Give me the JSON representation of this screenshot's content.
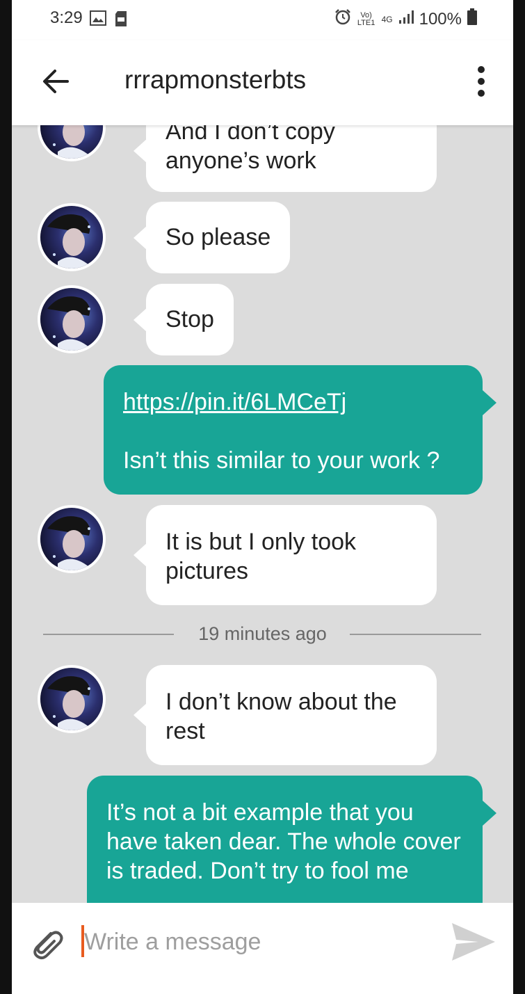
{
  "status_bar": {
    "time": "3:29",
    "battery": "100%",
    "network": "4G",
    "volte": "Vo) LTE1"
  },
  "header": {
    "title": "rrrapmonsterbts"
  },
  "messages": [
    {
      "side": "in",
      "text": "And I don’t copy anyone’s work"
    },
    {
      "side": "in",
      "text": "So please"
    },
    {
      "side": "in",
      "text": "Stop"
    },
    {
      "side": "out",
      "link": "https://pin.it/6LMCeTj",
      "text": "Isn’t this similar to your work ?"
    },
    {
      "side": "in",
      "text": "It is but I only took pictures"
    },
    {
      "side": "in",
      "text": "I don’t know about the rest"
    },
    {
      "side": "out",
      "text": "It’s not a bit example that you have taken dear. The whole cover is traded. Don’t try to fool me"
    }
  ],
  "timestamp": "19 minutes ago",
  "composer": {
    "placeholder": "Write a message"
  },
  "colors": {
    "outgoing": "#18a596",
    "incoming": "#ffffff",
    "background": "#dcdcdc",
    "cursor": "#e85b1f"
  },
  "icons": [
    "back-arrow-icon",
    "more-vert-icon",
    "paperclip-icon",
    "send-icon",
    "alarm-icon",
    "signal-icon",
    "battery-icon",
    "gallery-icon"
  ]
}
